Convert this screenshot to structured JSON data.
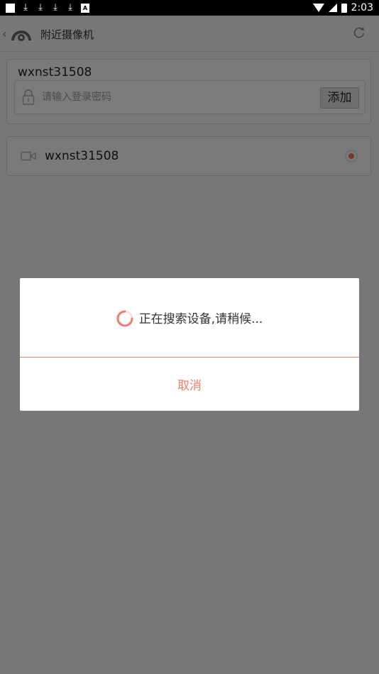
{
  "status_bar": {
    "time": "2:03",
    "left_icons": [
      "notification-square-icon",
      "download-icon",
      "download-icon",
      "download-icon",
      "download-icon",
      "a-badge-icon"
    ],
    "right_icons": [
      "wifi-icon",
      "signal-icon",
      "battery-charging-icon"
    ]
  },
  "header": {
    "title": "附近摄像机",
    "back_icon": "chevron-left-icon",
    "logo_icon": "camera-eye-logo-icon",
    "refresh_icon": "refresh-icon"
  },
  "add_card": {
    "device_name": "wxnst31508",
    "password_placeholder": "请输入登录密码",
    "password_value": "",
    "add_label": "添加"
  },
  "device_list": [
    {
      "name": "wxnst31508",
      "selected": true
    }
  ],
  "dialog": {
    "message": "正在搜索设备,请稍候...",
    "cancel_label": "取消"
  },
  "colors": {
    "accent": "#f07d67",
    "radio_selected": "#e2745a",
    "overlay": "rgba(0,0,0,0.5)"
  }
}
